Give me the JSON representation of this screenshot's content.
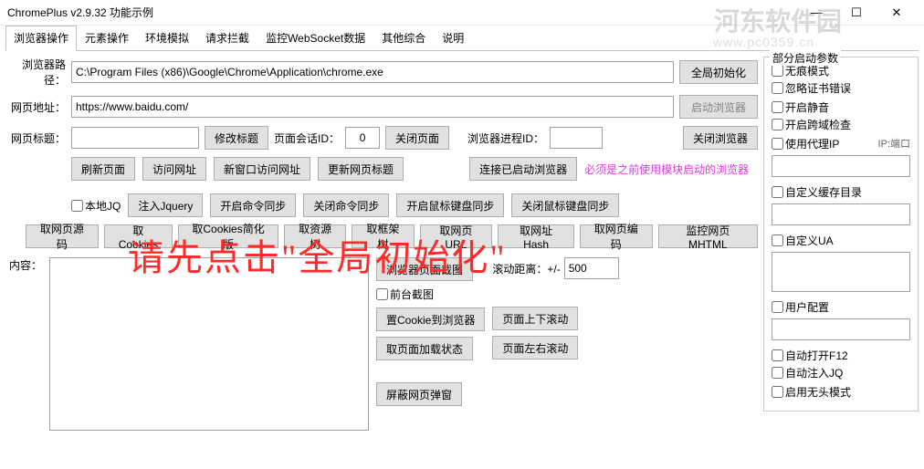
{
  "window": {
    "title": "ChromePlus v2.9.32 功能示例"
  },
  "tabs": [
    "浏览器操作",
    "元素操作",
    "环境模拟",
    "请求拦截",
    "监控WebSocket数据",
    "其他综合",
    "说明"
  ],
  "labels": {
    "browser_path": "浏览器路径：",
    "web_url": "网页地址：",
    "web_title": "网页标题：",
    "content": "内容："
  },
  "inputs": {
    "browser_path": "C:\\Program Files (x86)\\Google\\Chrome\\Application\\chrome.exe",
    "web_url": "https://www.baidu.com/",
    "web_title": "",
    "session_id": "0",
    "process_id": "",
    "scroll_dist": "500",
    "proxyip": "",
    "cache_dir": "",
    "custom_ua": "",
    "user_config": ""
  },
  "buttons": {
    "global_init": "全局初始化",
    "start_browser": "启动浏览器",
    "modify_title": "修改标题",
    "session_lbl": "页面会话ID：",
    "close_page": "关闭页面",
    "process_lbl": "浏览器进程ID：",
    "close_browser": "关闭浏览器",
    "refresh": "刷新页面",
    "visit": "访问网址",
    "new_window_visit": "新窗口访问网址",
    "update_title": "更新网页标题",
    "connect_started": "连接已启动浏览器",
    "inject_jq": "注入Jquery",
    "open_cmd_sync": "开启命令同步",
    "close_cmd_sync": "关闭命令同步",
    "open_mouse_sync": "开启鼠标键盘同步",
    "close_mouse_sync": "关闭鼠标键盘同步",
    "get_source": "取网页源码",
    "get_cookies": "取Cookies",
    "get_cookies_simple": "取Cookies简化版",
    "get_resource": "取资源树",
    "get_frame_tree": "取框架树",
    "get_page_url": "取网页URL",
    "get_url_hash": "取网址Hash",
    "get_page_encoding": "取网页编码",
    "monitor_web_mhtml": "监控网页MHTML",
    "screenshot": "浏览器页面截图",
    "set_cookie": "置Cookie到浏览器",
    "get_load_status": "取页面加载状态",
    "block_popup": "屏蔽网页弹窗",
    "scroll_ud": "页面上下滚动",
    "scroll_lr": "页面左右滚动"
  },
  "checkboxes": {
    "local_jq": "本地JQ",
    "front_screenshot": "前台截图",
    "incognito": "无痕模式",
    "ignore_cert": "忽略证书错误",
    "mute": "开启静音",
    "cors": "开启跨域检查",
    "use_proxy": "使用代理IP",
    "custom_cache": "自定义缓存目录",
    "custom_ua": "自定义UA",
    "user_config": "用户配置",
    "auto_f12": "自动打开F12",
    "auto_inject_jq": "自动注入JQ",
    "headless": "启用无头模式"
  },
  "texts": {
    "notice": "必须是之前使用模块启动的浏览器",
    "scroll_lbl": "滚动距离：+/-",
    "startup_params": "部分启动参数",
    "ip_port": "IP:端口",
    "overlay": "请先点击\"全局初始化\"",
    "wm1": "河东软件园",
    "wm2": "www.pc0359.cn"
  }
}
